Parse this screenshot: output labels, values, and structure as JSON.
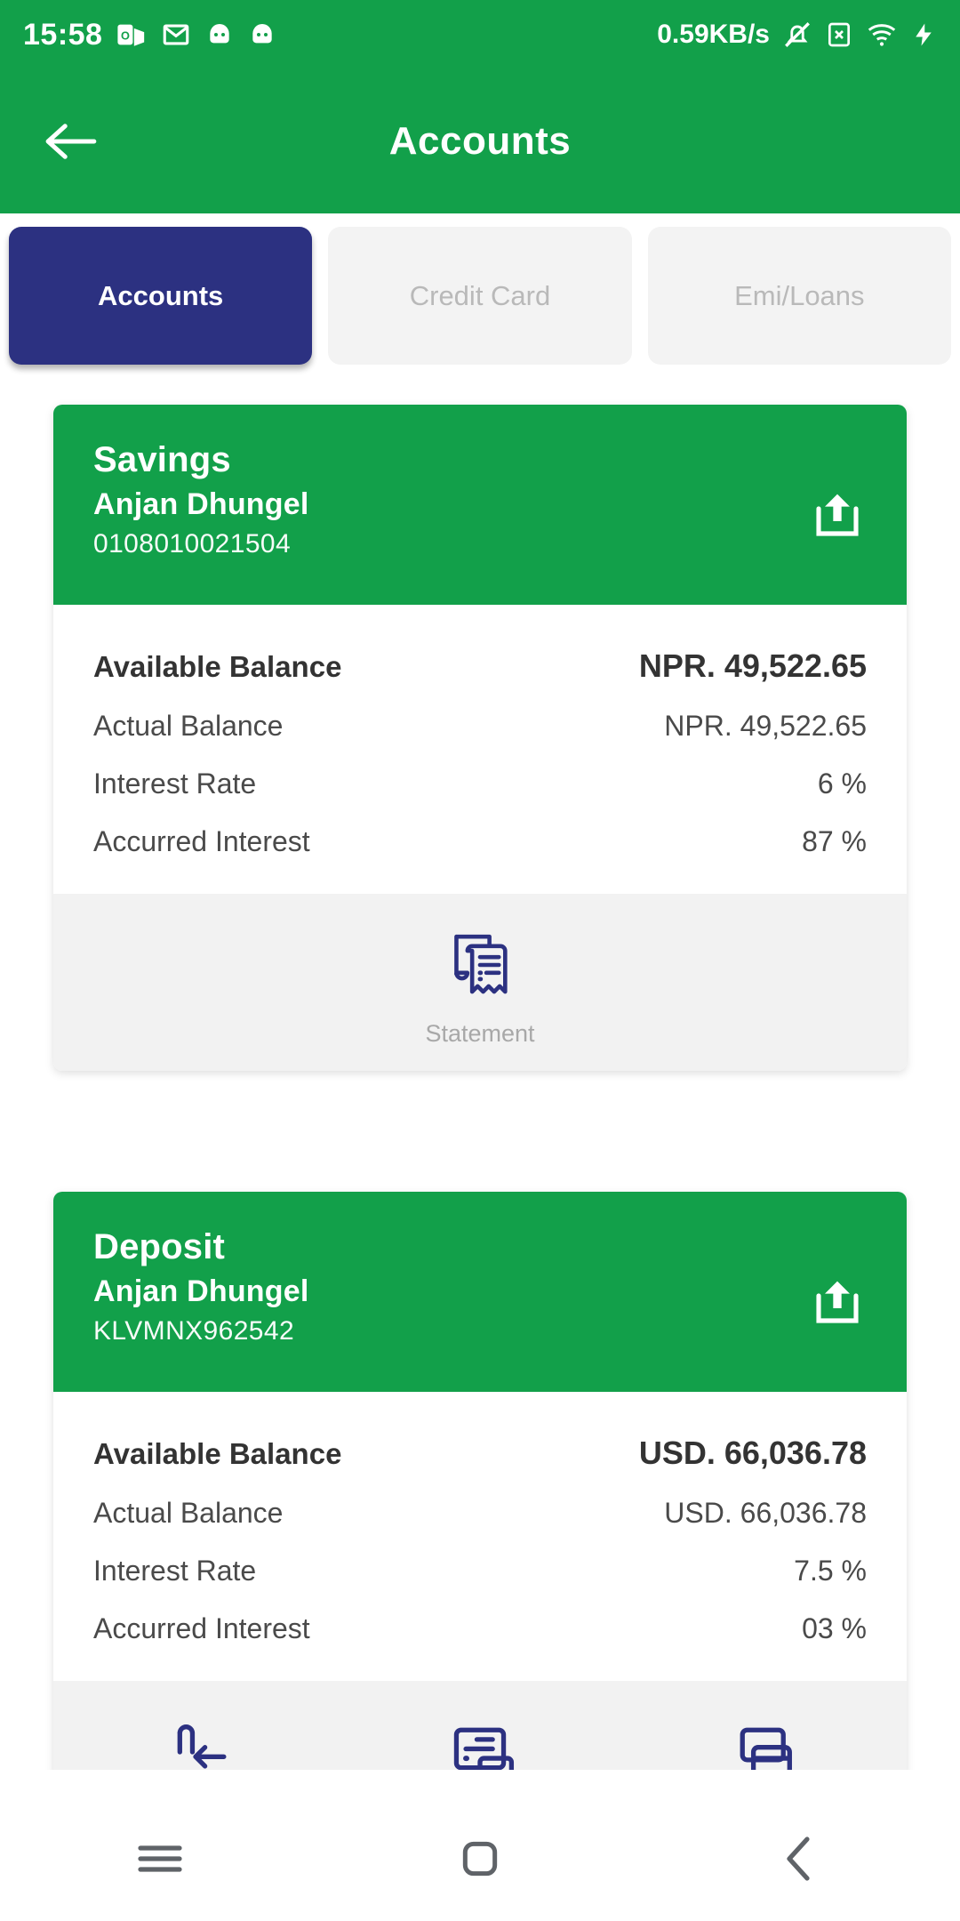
{
  "status_bar": {
    "time": "15:58",
    "network_speed": "0.59KB/s",
    "left_icons": [
      "outlook-icon",
      "gmail-icon",
      "android-icon",
      "android-icon"
    ],
    "right_icons": [
      "mute-notifications-icon",
      "sim-x-icon",
      "wifi-icon",
      "charging-bolt-icon"
    ]
  },
  "app_bar": {
    "title": "Accounts",
    "back_icon": "arrow-left-icon",
    "background_color": "#12a04a"
  },
  "tabs": [
    {
      "label": "Accounts",
      "active": true
    },
    {
      "label": "Credit Card",
      "active": false
    },
    {
      "label": "Emi/Loans",
      "active": false
    }
  ],
  "theme": {
    "green": "#12a04a",
    "navy": "#2c3181",
    "inactive_tab_bg": "#f3f3f3",
    "inactive_tab_text": "#b9b9b9",
    "action_strip_bg": "#f2f2f2"
  },
  "accounts": [
    {
      "type": "Savings",
      "holder": "Anjan Dhungel",
      "number": "0108010021504",
      "share_icon": "share-export-icon",
      "rows": [
        {
          "label": "Available Balance",
          "value": "NPR. 49,522.65",
          "primary": true
        },
        {
          "label": "Actual Balance",
          "value": "NPR. 49,522.65",
          "primary": false
        },
        {
          "label": "Interest Rate",
          "value": "6 %",
          "primary": false
        },
        {
          "label": "Accurred Interest",
          "value": "87 %",
          "primary": false
        }
      ],
      "actions": [
        {
          "label": "Statement",
          "icon": "statement-receipt-icon"
        }
      ]
    },
    {
      "type": "Deposit",
      "holder": "Anjan Dhungel",
      "number": "KLVMNX962542",
      "share_icon": "share-export-icon",
      "rows": [
        {
          "label": "Available Balance",
          "value": "USD. 66,036.78",
          "primary": true
        },
        {
          "label": "Actual Balance",
          "value": "USD. 66,036.78",
          "primary": false
        },
        {
          "label": "Interest Rate",
          "value": "7.5 %",
          "primary": false
        },
        {
          "label": "Accurred Interest",
          "value": "03 %",
          "primary": false
        }
      ],
      "actions": [
        {
          "label": "",
          "icon": "transfer-arrow-icon"
        },
        {
          "label": "",
          "icon": "card-statement-icon"
        },
        {
          "label": "",
          "icon": "cards-icon"
        }
      ]
    }
  ],
  "bottom_nav": [
    {
      "icon": "recents-hamburger-icon"
    },
    {
      "icon": "home-square-icon"
    },
    {
      "icon": "back-chevron-icon"
    }
  ]
}
